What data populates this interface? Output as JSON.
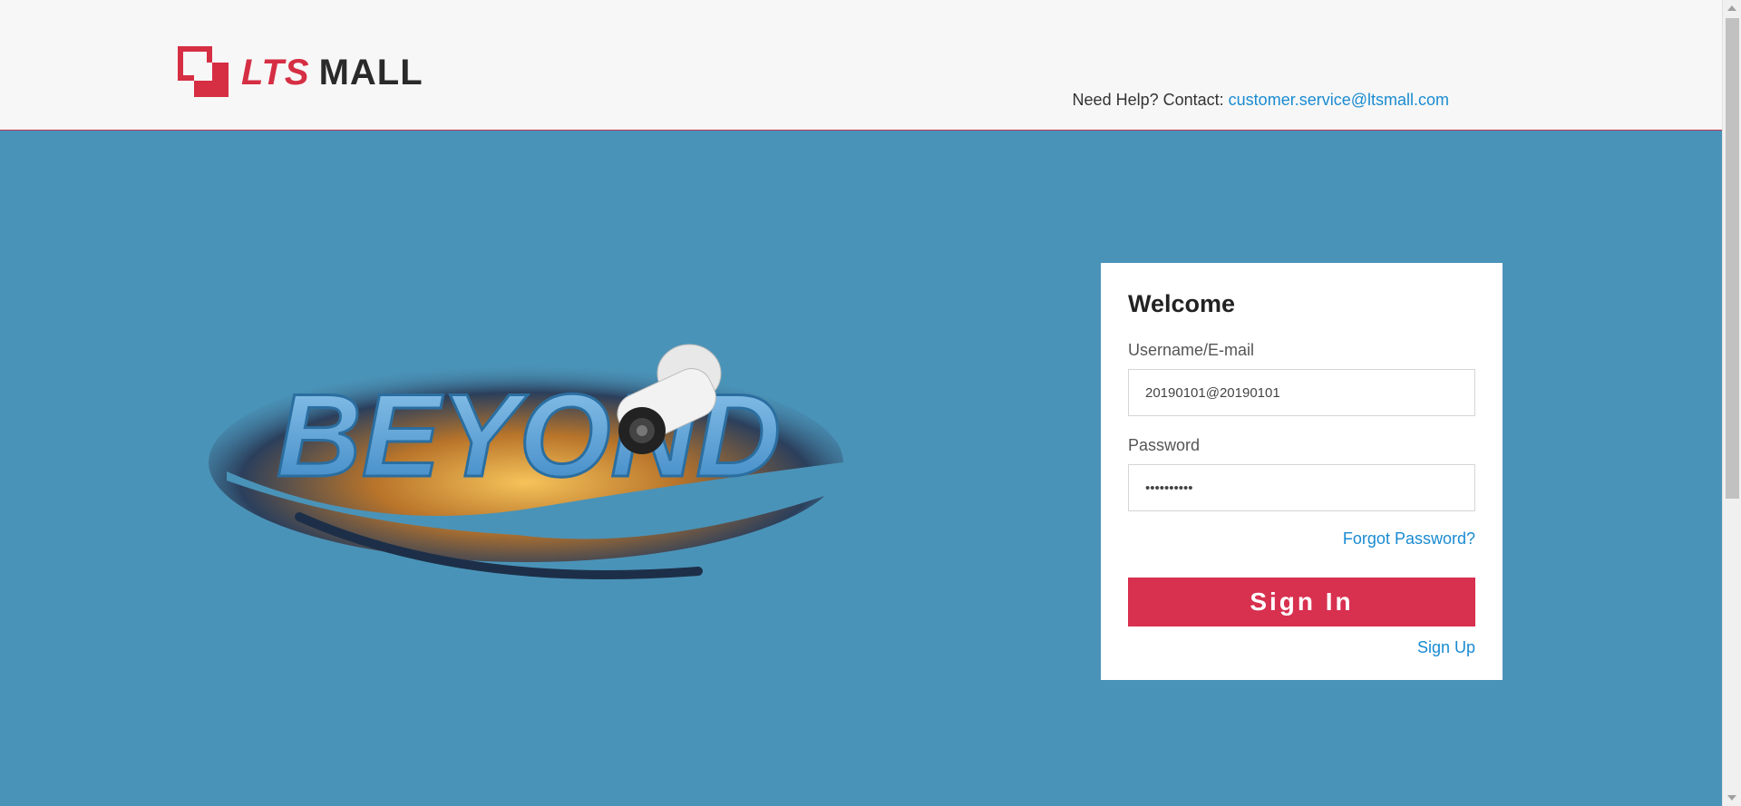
{
  "header": {
    "logo": {
      "brand": "LTS",
      "name": "MALL"
    },
    "help_prefix": "Need Help? Contact:",
    "help_email": "customer.service@ltsmall.com"
  },
  "hero": {
    "text": "BEYOND",
    "icons": [
      "city-night-icon",
      "security-camera-icon"
    ]
  },
  "login": {
    "title": "Welcome",
    "username_label": "Username/E-mail",
    "username_value": "20190101@20190101",
    "password_label": "Password",
    "password_value": "••••••••••",
    "forgot_label": "Forgot Password?",
    "signin_label": "Sign In",
    "signup_label": "Sign Up"
  },
  "colors": {
    "accent": "#d8304f",
    "link": "#1a8bd1",
    "background": "#4a93b8",
    "header_bg": "#f7f7f7"
  }
}
